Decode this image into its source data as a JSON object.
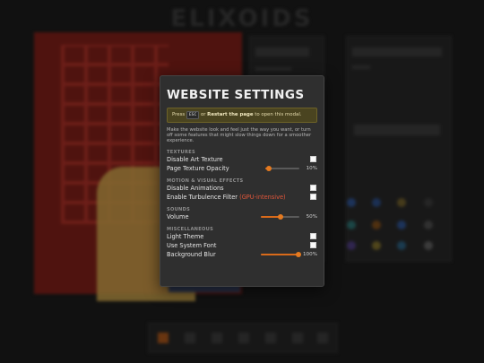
{
  "background": {
    "logo_text": "ELIXOIDS"
  },
  "modal": {
    "title": "WEBSITE SETTINGS",
    "notice": {
      "press": "Press",
      "key": "ESC",
      "or": "or",
      "restart_link": "Restart the page",
      "suffix": "to open this modal."
    },
    "description": "Make the website look and feel just the way you want, or turn off some features that might slow things down for a smoother experience.",
    "sections": {
      "textures": {
        "title": "TEXTURES",
        "disable_art_texture": {
          "label": "Disable Art Texture",
          "checked": false
        },
        "page_texture_opacity": {
          "label": "Page Texture Opacity",
          "value_text": "10%",
          "value": 0.1
        }
      },
      "motion": {
        "title": "MOTION & VISUAL EFFECTS",
        "disable_animations": {
          "label": "Disable Animations",
          "checked": false
        },
        "turbulence_filter": {
          "label": "Enable Turbulence Filter",
          "note": "(GPU-intensive)",
          "checked": false
        }
      },
      "sounds": {
        "title": "SOUNDS",
        "volume": {
          "label": "Volume",
          "value_text": "50%",
          "value": 0.5
        }
      },
      "misc": {
        "title": "MISCELLANEOUS",
        "light_theme": {
          "label": "Light Theme",
          "checked": false
        },
        "system_font": {
          "label": "Use System Font",
          "checked": false
        },
        "background_blur": {
          "label": "Background Blur",
          "value_text": "100%",
          "value": 1.0
        }
      }
    },
    "colors": {
      "accent": "#e57a20",
      "warning": "#e0563a",
      "notice_bg": "#4a4420"
    }
  }
}
